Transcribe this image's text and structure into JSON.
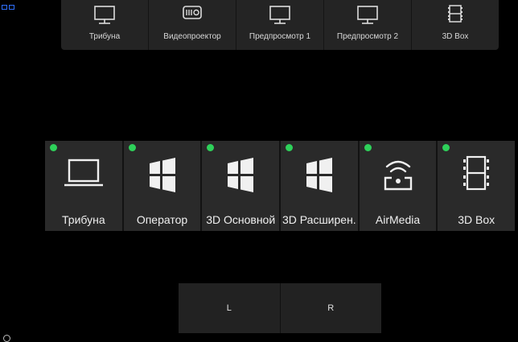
{
  "outputs": [
    {
      "label": "Трибуна",
      "icon": "monitor-icon"
    },
    {
      "label": "Видеопроектор",
      "icon": "projector-icon"
    },
    {
      "label": "Предпросмотр 1",
      "icon": "monitor-icon"
    },
    {
      "label": "Предпросмотр 2",
      "icon": "monitor-icon"
    },
    {
      "label": "3D Box",
      "icon": "film-icon"
    }
  ],
  "sources": [
    {
      "label": "Трибуна",
      "icon": "laptop-icon",
      "status_color": "#2ed15a"
    },
    {
      "label": "Оператор",
      "icon": "windows-icon",
      "status_color": "#2ed15a"
    },
    {
      "label": "3D Основной",
      "icon": "windows-icon",
      "status_color": "#2ed15a"
    },
    {
      "label": "3D Расширен.",
      "icon": "windows-icon",
      "status_color": "#2ed15a"
    },
    {
      "label": "AirMedia",
      "icon": "airmedia-icon",
      "status_color": "#2ed15a"
    },
    {
      "label": "3D Box",
      "icon": "film-icon",
      "status_color": "#2ed15a"
    }
  ],
  "channels": {
    "left_label": "L",
    "right_label": "R"
  }
}
